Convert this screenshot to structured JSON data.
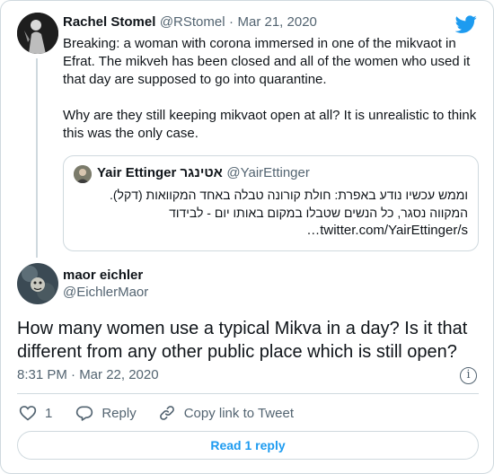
{
  "tweet1": {
    "name": "Rachel Stomel",
    "handle": "@RStomel",
    "date": "Mar 21, 2020",
    "dot": "·",
    "para1": "Breaking: a woman with corona immersed in one of the mikvaot in Efrat. The mikveh has been closed and all of the women who used it that day are supposed to go into quarantine.",
    "para2": "Why are they still keeping mikvaot open at all? It is unrealistic to think this was the only case."
  },
  "quote": {
    "name": "Yair Ettinger אטינגר",
    "handle": "@YairEttinger",
    "line1": "וממש עכשיו נודע באפרת: חולת קורונה טבלה באחד המקוואות (דקל).",
    "line2": "המקווה נסגר, כל הנשים שטבלו במקום באותו יום - לבידוד",
    "link": "twitter.com/YairEttinger/s…"
  },
  "tweet2": {
    "name": "maor eichler",
    "handle": "@EichlerMaor",
    "text": "How many women use a typical Mikva in a day? Is it that different from any other public place which is still open?",
    "time": "8:31 PM · Mar 22, 2020",
    "info_icon": "i"
  },
  "actions": {
    "like_count": "1",
    "reply_label": "Reply",
    "copy_label": "Copy link to Tweet"
  },
  "read_replies": "Read 1 reply",
  "colors": {
    "accent": "#1d9bf0",
    "muted": "#536471",
    "border": "#cfd9de"
  }
}
